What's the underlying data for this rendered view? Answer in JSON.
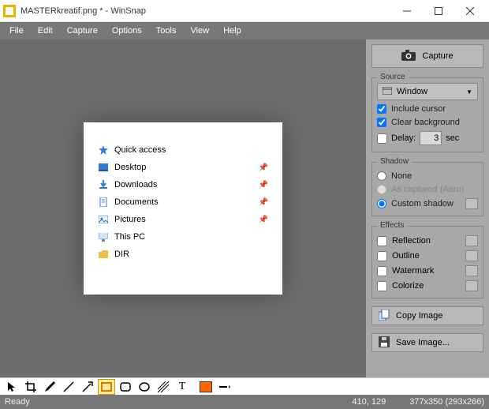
{
  "window": {
    "title": "MASTERkreatif.png * - WinSnap"
  },
  "menu": {
    "file": "File",
    "edit": "Edit",
    "capture": "Capture",
    "options": "Options",
    "tools": "Tools",
    "view": "View",
    "help": "Help"
  },
  "preview": {
    "quick_access": "Quick access",
    "items": [
      {
        "label": "Desktop"
      },
      {
        "label": "Downloads"
      },
      {
        "label": "Documents"
      },
      {
        "label": "Pictures"
      },
      {
        "label": "This PC"
      },
      {
        "label": "DIR"
      }
    ]
  },
  "side": {
    "capture": "Capture",
    "source": {
      "legend": "Source",
      "mode": "Window",
      "include_cursor": "Include cursor",
      "clear_background": "Clear background",
      "delay_label": "Delay:",
      "delay_value": "3",
      "delay_unit": "sec"
    },
    "shadow": {
      "legend": "Shadow",
      "none": "None",
      "as_captured": "As captured (Aero)",
      "custom": "Custom shadow"
    },
    "effects": {
      "legend": "Effects",
      "reflection": "Reflection",
      "outline": "Outline",
      "watermark": "Watermark",
      "colorize": "Colorize"
    },
    "copy_image": "Copy Image",
    "save_image": "Save Image..."
  },
  "status": {
    "ready": "Ready",
    "pos": "410, 129",
    "size": "377x350 (293x266)"
  }
}
